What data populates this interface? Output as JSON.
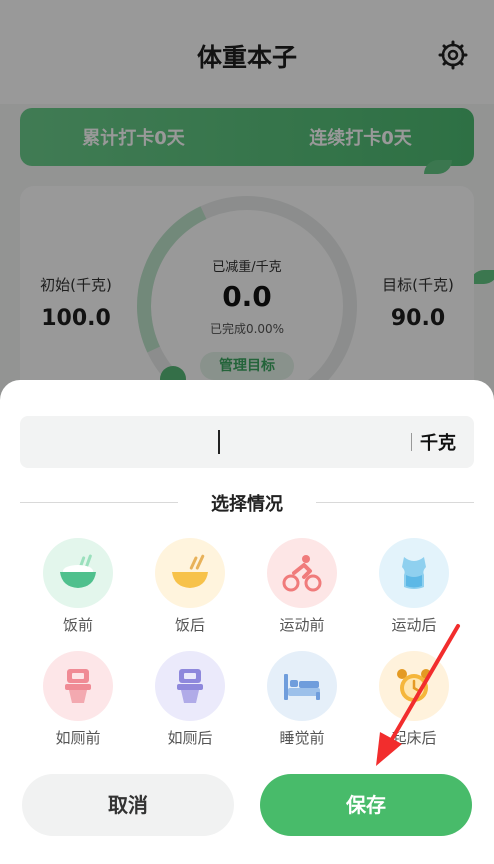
{
  "header": {
    "title": "体重本子"
  },
  "checkin": {
    "total": "累计打卡0天",
    "streak": "连续打卡0天"
  },
  "stats": {
    "initial_label": "初始(千克)",
    "initial_value": "100.0",
    "lost_label": "已减重/千克",
    "lost_value": "0.0",
    "progress_text": "已完成0.00%",
    "target_label": "目标(千克)",
    "target_value": "90.0",
    "manage_label": "管理目标"
  },
  "sheet": {
    "weight_value": "",
    "unit": "千克",
    "section_title": "选择情况",
    "options": [
      {
        "label": "饭前",
        "icon": "bowl-icon",
        "bg": "#e3f6ec",
        "color": "#4fc08d"
      },
      {
        "label": "饭后",
        "icon": "bowl-icon",
        "bg": "#fff4dd",
        "color": "#f7c24a"
      },
      {
        "label": "运动前",
        "icon": "cycling-icon",
        "bg": "#fde6e6",
        "color": "#f07b7b"
      },
      {
        "label": "运动后",
        "icon": "shirt-icon",
        "bg": "#e3f3fb",
        "color": "#5db8e6"
      },
      {
        "label": "如厕前",
        "icon": "toilet-icon",
        "bg": "#fde6e8",
        "color": "#f08b95"
      },
      {
        "label": "如厕后",
        "icon": "toilet-icon",
        "bg": "#ebeafb",
        "color": "#8e88dc"
      },
      {
        "label": "睡觉前",
        "icon": "bed-icon",
        "bg": "#e5eff9",
        "color": "#6f9ddc"
      },
      {
        "label": "起床后",
        "icon": "alarm-clock-icon",
        "bg": "#fff2dc",
        "color": "#f5b63b"
      }
    ],
    "cancel_label": "取消",
    "save_label": "保存"
  },
  "colors": {
    "accent": "#48bb6a",
    "overlay": "rgba(0,0,0,0.4)"
  }
}
